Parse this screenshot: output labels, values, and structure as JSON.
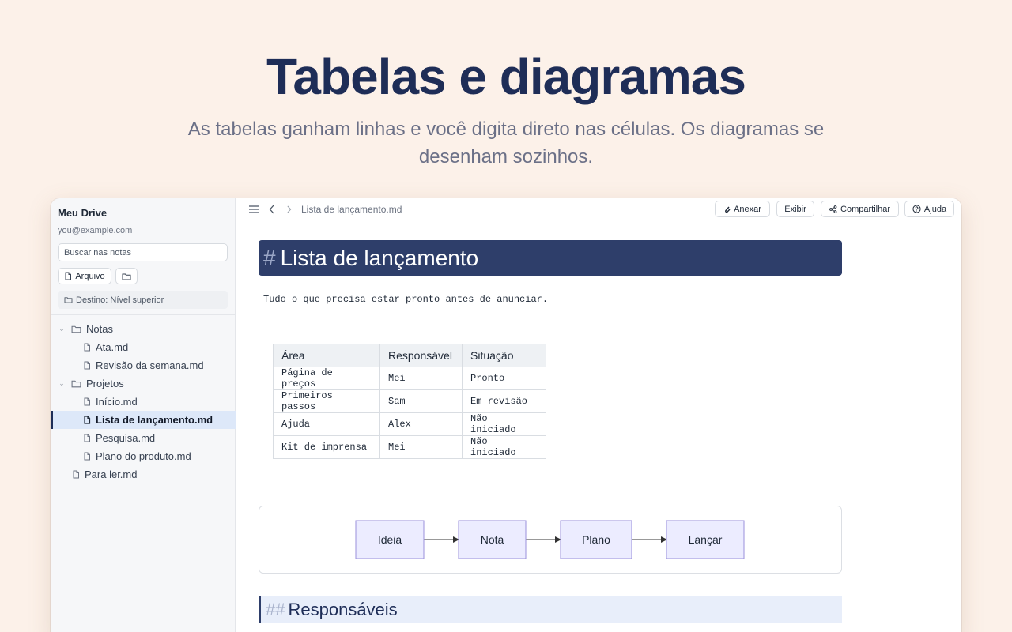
{
  "hero": {
    "title": "Tabelas e diagramas",
    "subtitle": "As tabelas ganham linhas e você digita direto nas células. Os diagramas se desenham sozinhos."
  },
  "sidebar": {
    "title": "Meu Drive",
    "email": "you@example.com",
    "search_placeholder": "Buscar nas notas",
    "file_button": "Arquivo",
    "destination": "Destino: Nível superior",
    "tree": {
      "notas": {
        "label": "Notas",
        "children": [
          "Ata.md",
          "Revisão da semana.md"
        ]
      },
      "projetos": {
        "label": "Projetos",
        "children": [
          "Início.md",
          "Lista de lançamento.md",
          "Pesquisa.md",
          "Plano do produto.md"
        ]
      },
      "root_file": "Para ler.md"
    }
  },
  "topbar": {
    "path": "Lista de lançamento.md",
    "buttons": {
      "attach": "Anexar",
      "view": "Exibir",
      "share": "Compartilhar",
      "help": "Ajuda"
    }
  },
  "doc": {
    "h1_hash": "#",
    "h1": "Lista de lançamento",
    "paragraph": "Tudo o que precisa estar pronto antes de anunciar.",
    "table": {
      "headers": [
        "Área",
        "Responsável",
        "Situação"
      ],
      "rows": [
        [
          "Página de preços",
          "Mei",
          "Pronto"
        ],
        [
          "Primeiros passos",
          "Sam",
          "Em revisão"
        ],
        [
          "Ajuda",
          "Alex",
          "Não iniciado"
        ],
        [
          "Kit de imprensa",
          "Mei",
          "Não iniciado"
        ]
      ]
    },
    "diagram": {
      "nodes": [
        "Ideia",
        "Nota",
        "Plano",
        "Lançar"
      ]
    },
    "h2_hash": "##",
    "h2": "Responsáveis"
  },
  "colors": {
    "accent": "#2e3e6a",
    "hero_title": "#1e2d57",
    "selection": "#dde8f9",
    "diagram_node": "#ececff"
  }
}
